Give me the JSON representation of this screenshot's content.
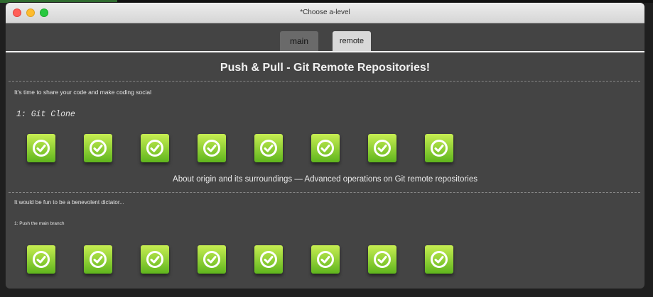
{
  "window": {
    "title": "*Choose a-level"
  },
  "tabs": [
    {
      "label": "main"
    },
    {
      "label": "remote"
    }
  ],
  "section1": {
    "heading": "Push & Pull - Git Remote Repositories!",
    "description": "It's time to share your code and make coding social",
    "level_title": "1: Git Clone",
    "badges": [
      {
        "icon": "check-icon",
        "completed": true
      },
      {
        "icon": "check-icon",
        "completed": true
      },
      {
        "icon": "check-icon",
        "completed": true
      },
      {
        "icon": "check-icon",
        "completed": true
      },
      {
        "icon": "check-icon",
        "completed": true
      },
      {
        "icon": "check-icon",
        "completed": true
      },
      {
        "icon": "check-icon",
        "completed": true
      },
      {
        "icon": "check-icon",
        "completed": true
      }
    ]
  },
  "section2": {
    "heading": "About origin and its surroundings — Advanced operations on Git remote repositories",
    "description": "It would be fun to be a benevolent dictator...",
    "level_title": "1: Push the main branch",
    "badges": [
      {
        "icon": "check-icon",
        "completed": true
      },
      {
        "icon": "check-icon",
        "completed": true
      },
      {
        "icon": "check-icon",
        "completed": true
      },
      {
        "icon": "check-icon",
        "completed": true
      },
      {
        "icon": "check-icon",
        "completed": true
      },
      {
        "icon": "check-icon",
        "completed": true
      },
      {
        "icon": "check-icon",
        "completed": true
      },
      {
        "icon": "check-icon",
        "completed": true
      }
    ]
  },
  "colors": {
    "badge_top": "#c7ee52",
    "badge_bottom": "#5fb51d",
    "window_bg": "#444444"
  }
}
